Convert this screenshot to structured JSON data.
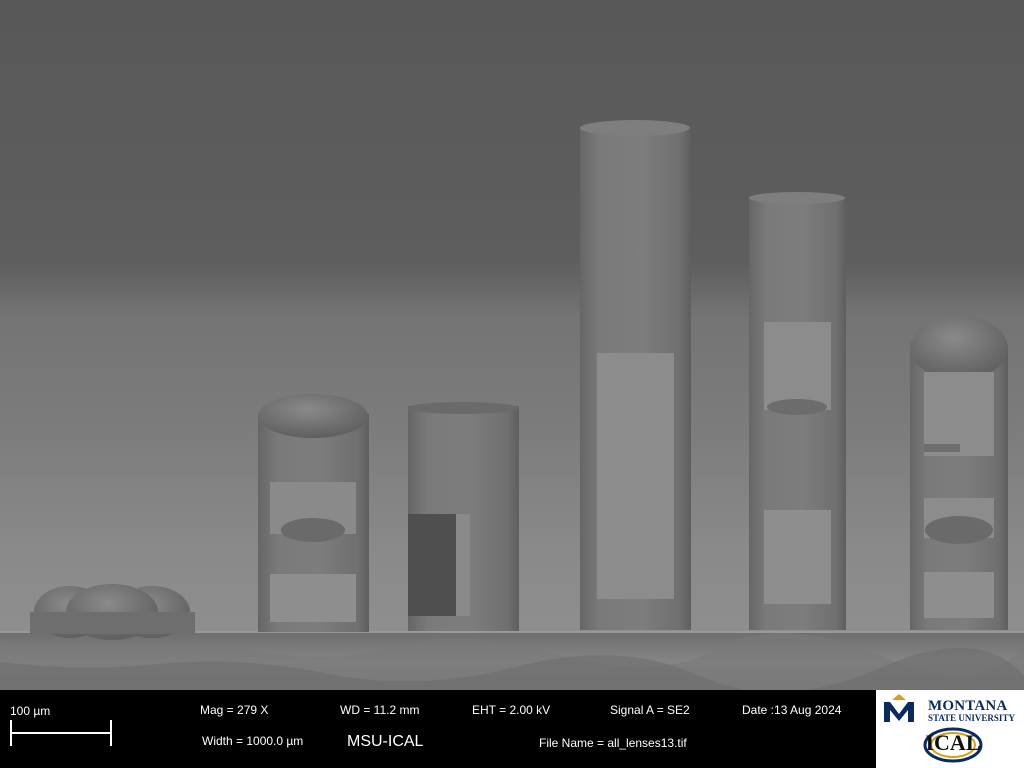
{
  "image": {
    "description_icon": "sem-micrograph-icon"
  },
  "info_bar": {
    "scale_label": "100 µm",
    "mag": "Mag =     279 X",
    "width": "Width = 1000.0 µm",
    "wd": "WD = 11.2 mm",
    "instrument": "MSU-ICAL",
    "eht": "EHT =  2.00 kV",
    "signal": "Signal A = SE2",
    "file_name": "File Name = all_lenses13.tif",
    "date": "Date :13 Aug 2024"
  },
  "logo": {
    "university": "MONTANA",
    "university_sub": "STATE UNIVERSITY",
    "lab": "ICAL"
  }
}
